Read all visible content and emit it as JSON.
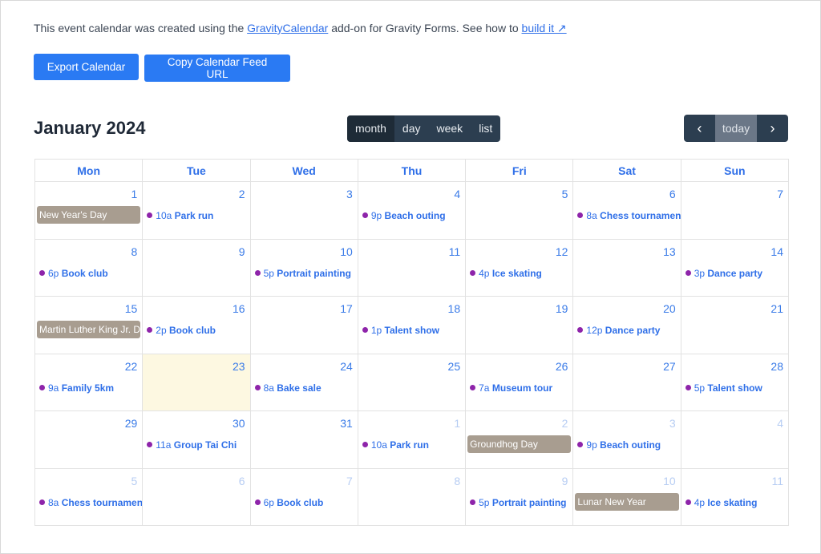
{
  "intro": {
    "text1": "This event calendar was created using the ",
    "link1": "GravityCalendar",
    "text2": " add-on for Gravity Forms. See how to ",
    "link2": "build it ↗"
  },
  "buttons": {
    "export": "Export Calendar",
    "copy": "Copy Calendar Feed URL"
  },
  "title": "January 2024",
  "views": [
    "month",
    "day",
    "week",
    "list"
  ],
  "nav": {
    "prev": "‹",
    "today": "today",
    "next": "›"
  },
  "weekdays": [
    "Mon",
    "Tue",
    "Wed",
    "Thu",
    "Fri",
    "Sat",
    "Sun"
  ],
  "weeks": [
    [
      {
        "d": "1",
        "hol": "New Year's Day"
      },
      {
        "d": "2",
        "t": "10a",
        "e": "Park run"
      },
      {
        "d": "3"
      },
      {
        "d": "4",
        "t": "9p",
        "e": "Beach outing"
      },
      {
        "d": "5"
      },
      {
        "d": "6",
        "t": "8a",
        "e": "Chess tournament"
      },
      {
        "d": "7"
      }
    ],
    [
      {
        "d": "8",
        "t": "6p",
        "e": "Book club"
      },
      {
        "d": "9"
      },
      {
        "d": "10",
        "t": "5p",
        "e": "Portrait painting"
      },
      {
        "d": "11"
      },
      {
        "d": "12",
        "t": "4p",
        "e": "Ice skating"
      },
      {
        "d": "13"
      },
      {
        "d": "14",
        "t": "3p",
        "e": "Dance party"
      }
    ],
    [
      {
        "d": "15",
        "hol": "Martin Luther King Jr. Day"
      },
      {
        "d": "16",
        "t": "2p",
        "e": "Book club"
      },
      {
        "d": "17"
      },
      {
        "d": "18",
        "t": "1p",
        "e": "Talent show"
      },
      {
        "d": "19"
      },
      {
        "d": "20",
        "t": "12p",
        "e": "Dance party"
      },
      {
        "d": "21"
      }
    ],
    [
      {
        "d": "22",
        "t": "9a",
        "e": "Family 5km"
      },
      {
        "d": "23",
        "today": true
      },
      {
        "d": "24",
        "t": "8a",
        "e": "Bake sale"
      },
      {
        "d": "25"
      },
      {
        "d": "26",
        "t": "7a",
        "e": "Museum tour"
      },
      {
        "d": "27"
      },
      {
        "d": "28",
        "t": "5p",
        "e": "Talent show"
      }
    ],
    [
      {
        "d": "29"
      },
      {
        "d": "30",
        "t": "11a",
        "e": "Group Tai Chi"
      },
      {
        "d": "31"
      },
      {
        "d": "1",
        "other": true,
        "t": "10a",
        "e": "Park run"
      },
      {
        "d": "2",
        "other": true,
        "hol": "Groundhog Day"
      },
      {
        "d": "3",
        "other": true,
        "t": "9p",
        "e": "Beach outing"
      },
      {
        "d": "4",
        "other": true
      }
    ],
    [
      {
        "d": "5",
        "other": true,
        "t": "8a",
        "e": "Chess tournament"
      },
      {
        "d": "6",
        "other": true
      },
      {
        "d": "7",
        "other": true,
        "t": "6p",
        "e": "Book club"
      },
      {
        "d": "8",
        "other": true
      },
      {
        "d": "9",
        "other": true,
        "t": "5p",
        "e": "Portrait painting"
      },
      {
        "d": "10",
        "other": true,
        "hol": "Lunar New Year"
      },
      {
        "d": "11",
        "other": true,
        "t": "4p",
        "e": "Ice skating"
      }
    ]
  ]
}
